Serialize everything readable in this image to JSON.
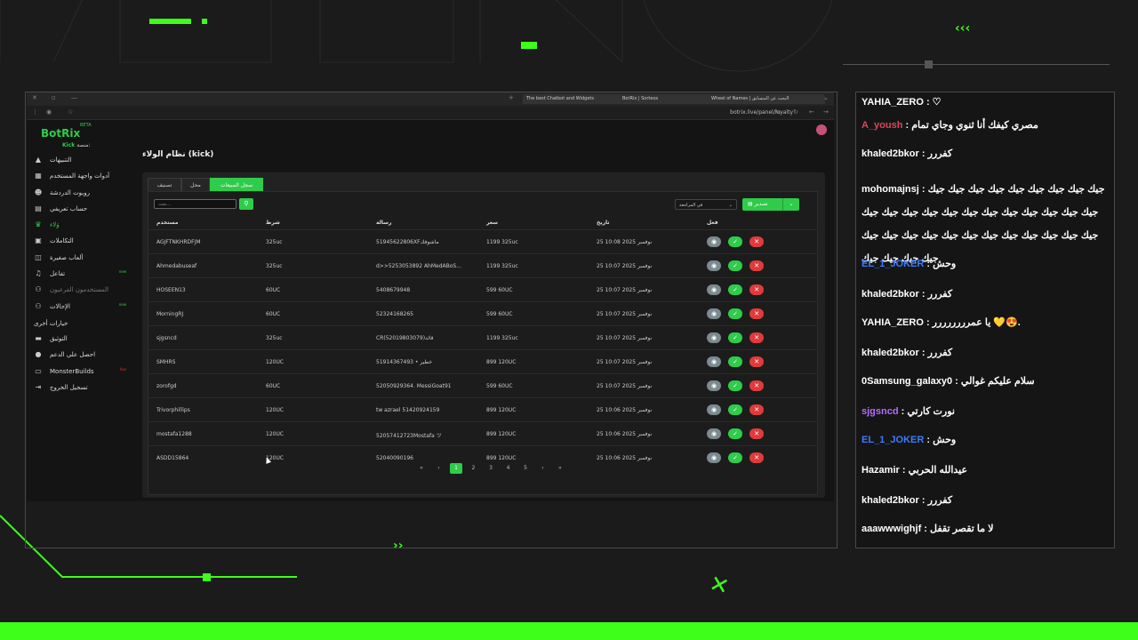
{
  "colors": {
    "accent": "#2ecc4a",
    "overlay_green": "#3dff1a",
    "danger": "#e03b3b",
    "view": "#7a8a8f"
  },
  "browser": {
    "tabs": [
      "The best Chatbot and Widgets",
      "BotRix | Sorteos",
      "Wheel of Names | البحث عن المتسابق"
    ],
    "url": "botrix.live/panel/loyalty"
  },
  "app": {
    "logo": "BotRix",
    "beta": "BETA",
    "platform_label": "منصة:",
    "platform_value": "Kick",
    "page_title": "نظام الولاء (kick)",
    "sidebar": [
      {
        "label": "التنبيهات",
        "icon": "alert-icon"
      },
      {
        "label": "أدوات واجهة المستخدم",
        "icon": "widgets-icon"
      },
      {
        "label": "روبوت الدردشة",
        "icon": "robot-icon"
      },
      {
        "label": "حساب تعريفي",
        "icon": "id-card-icon"
      },
      {
        "label": "وَلاء",
        "icon": "trophy-icon"
      },
      {
        "label": "التكاملات",
        "icon": "integrations-icon"
      },
      {
        "label": "ألعاب صغيرة",
        "icon": "gamepad-icon"
      },
      {
        "label": "تفاعل",
        "icon": "music-icon",
        "tag": "new"
      },
      {
        "label": "المستخدمون الفرعيون",
        "icon": "users-icon"
      },
      {
        "label": "الإحالات",
        "icon": "users-icon",
        "tag": "new"
      }
    ],
    "section_other": "خيارات أخرى",
    "sidebar_other": [
      {
        "label": "التوثيق",
        "icon": "document-icon"
      },
      {
        "label": "احصل على الدعم",
        "icon": "help-icon"
      },
      {
        "label": "MonsterBuilds",
        "icon": "monitor-icon",
        "tag": "live"
      },
      {
        "label": "تسجيل الخروج",
        "icon": "logout-icon"
      }
    ],
    "tabs": [
      "سجل المبيعات",
      "محل",
      "تصنيف"
    ],
    "search_placeholder": "بحث...",
    "select_value": "في المراجعة",
    "export_label": "تصدير",
    "columns": {
      "user": "مستخدم",
      "condition": "شرط",
      "message": "رسالة",
      "price": "سعر",
      "date": "تاريخ",
      "action": "فعل"
    },
    "rows": [
      {
        "user": "AGJFTNKHRDFJM",
        "condition": "325uc",
        "message": "51945622806XFماشوفك",
        "price": "1199 325uc",
        "date": "25 نوفمبر 2025 10:08"
      },
      {
        "user": "Ahmedabuseaf",
        "condition": "325uc",
        "message": "d>>5253053892 AhMedABoS...",
        "price": "1199 325uc",
        "date": "25 نوفمبر 2025 10:07"
      },
      {
        "user": "HOSEEN13",
        "condition": "60UC",
        "message": "5408679948",
        "price": "599 60UC",
        "date": "25 نوفمبر 2025 10:07"
      },
      {
        "user": "MorningRJ",
        "condition": "60UC",
        "message": "52324168265",
        "price": "599 60UC",
        "date": "25 نوفمبر 2025 10:07"
      },
      {
        "user": "sjgsncd",
        "condition": "325uc",
        "message": "CR(52019803079)قائد",
        "price": "1199 325uc",
        "date": "25 نوفمبر 2025 10:07"
      },
      {
        "user": "SMHRS",
        "condition": "120UC",
        "message": "51914367493 • خطير",
        "price": "899 120UC",
        "date": "25 نوفمبر 2025 10:07"
      },
      {
        "user": "zorofgd",
        "condition": "60UC",
        "message": "52050929364. MessiGoat91",
        "price": "599 60UC",
        "date": "25 نوفمبر 2025 10:07"
      },
      {
        "user": "Trivorphillips",
        "condition": "120UC",
        "message": "tw azrael 51420924159",
        "price": "899 120UC",
        "date": "25 نوفمبر 2025 10:06"
      },
      {
        "user": "mostafa1288",
        "condition": "120UC",
        "message": "52057412723Mostafa ツ",
        "price": "899 120UC",
        "date": "25 نوفمبر 2025 10:06"
      },
      {
        "user": "ASDD15864",
        "condition": "120UC",
        "message": "52040090196",
        "price": "899 120UC",
        "date": "25 نوفمبر 2025 10:06"
      }
    ],
    "pagination": [
      "«",
      "‹",
      "1",
      "2",
      "3",
      "4",
      "5",
      "›",
      "»"
    ]
  },
  "chat": [
    {
      "user": "YAHIA_ZERO",
      "color": "#ffffff",
      "text": "♡"
    },
    {
      "user": "A_yoush",
      "color": "#e0455a",
      "text": "مصري كيفك أنا ثنوي وجاي تمام"
    },
    {
      "user": "khaled2bkor",
      "color": "#ffffff",
      "text": "كفررر"
    },
    {
      "user": "mohomajnsj",
      "color": "#ffffff",
      "text": "جيك جيك جيك جيك جيك جيك جيك جيك جيك جيك جيك جيك جيك جيك جيك جيك جيك جيك جيك جيك جيك جيك جيك جيك جيك جيك جيك جيك جيك جيك جيك جيك جيك جيك جيك جيك جيك"
    },
    {
      "user": "EL_1_JOKER",
      "color": "#3d7bff",
      "text": "وحش"
    },
    {
      "user": "khaled2bkor",
      "color": "#ffffff",
      "text": "كفررر"
    },
    {
      "user": "YAHIA_ZERO",
      "color": "#ffffff",
      "text": "يا عمرررررررر 💛😍."
    },
    {
      "user": "khaled2bkor",
      "color": "#ffffff",
      "text": "كفررر"
    },
    {
      "user": "0Samsung_galaxy0",
      "color": "#ffffff",
      "text": "سلام عليكم غوالي"
    },
    {
      "user": "sjgsncd",
      "color": "#b46cff",
      "text": "نورت كارتي"
    },
    {
      "user": "EL_1_JOKER",
      "color": "#3d7bff",
      "text": "وحش"
    },
    {
      "user": "Hazamir",
      "color": "#ffffff",
      "text": "عيدالله الحربي"
    },
    {
      "user": "khaled2bkor",
      "color": "#ffffff",
      "text": "كفررر"
    },
    {
      "user": "aaawwwighjf",
      "color": "#ffffff",
      "text": "لا ما تقصر تقفل"
    }
  ]
}
